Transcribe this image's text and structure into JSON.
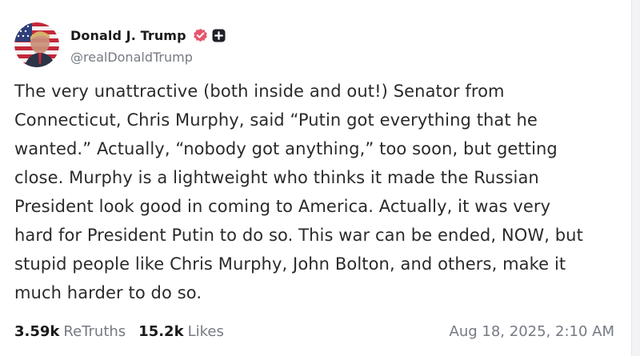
{
  "post": {
    "author": {
      "display_name": "Donald J. Trump",
      "handle": "@realDonaldTrump",
      "avatar_icon": "avatar-portrait-flag",
      "verified_icon": "verified-badge-icon",
      "verified_color": "#e8556e",
      "plus_icon": "plus-badge-icon"
    },
    "text": "The very unattractive (both inside and out!) Senator from\nConnecticut, Chris Murphy, said “Putin got everything that he\nwanted.” Actually, “nobody got anything,” too soon, but getting\nclose. Murphy is a lightweight who thinks it made the Russian\nPresident look good in coming to America. Actually, it was very\nhard for President Putin to do so. This war can be ended, NOW, but\nstupid people like Chris Murphy, John Bolton, and others, make it\nmuch harder to do so.",
    "stats": {
      "retruths_count": "3.59k",
      "retruths_label": "ReTruths",
      "likes_count": "15.2k",
      "likes_label": "Likes"
    },
    "timestamp": "Aug 18, 2025, 2:10 AM"
  }
}
